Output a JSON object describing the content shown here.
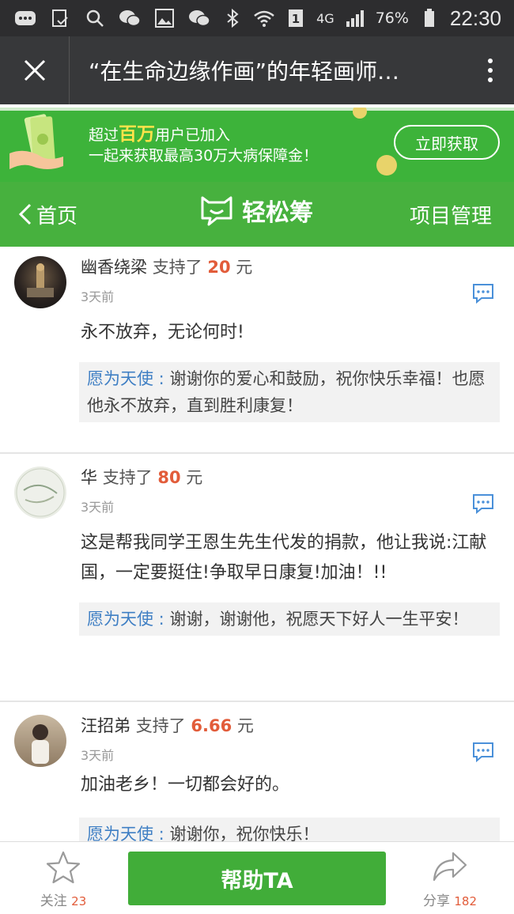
{
  "status_bar": {
    "network": "4G",
    "battery": "76%",
    "time": "22:30"
  },
  "title_bar": {
    "title": "“在生命边缘作画”的年轻画师…"
  },
  "banner": {
    "line1_pre": "超过",
    "line1_highlight": "百万",
    "line1_post": "用户已加入",
    "line2": "一起来获取最高30万大病保障金！",
    "button": "立即获取"
  },
  "nav": {
    "back_label": "首页",
    "brand": "轻松筹",
    "manage": "项目管理"
  },
  "comments": [
    {
      "name": "幽香绕梁",
      "support_prefix": "支持了",
      "amount": "20",
      "unit": "元",
      "time": "3天前",
      "message": "永不放弃，无论何时!",
      "reply_author": "愿为天使 :",
      "reply_text": " 谢谢你的爱心和鼓励，祝你快乐幸福！也愿他永不放弃，直到胜利康复！"
    },
    {
      "name": "华",
      "support_prefix": "支持了",
      "amount": "80",
      "unit": "元",
      "time": "3天前",
      "message": "这是帮我同学王恩生先生代发的捐款，他让我说:江献国，一定要挺住!争取早日康复!加油！!!",
      "reply_author": "愿为天使 :",
      "reply_text": " 谢谢，谢谢他，祝愿天下好人一生平安！"
    },
    {
      "name": "汪招弟",
      "support_prefix": "支持了",
      "amount": "6.66",
      "unit": "元",
      "time": "3天前",
      "message": "加油老乡！一切都会好的。",
      "reply_author": "愿为天使 :",
      "reply_text": " 谢谢你，祝你快乐！"
    }
  ],
  "bottom_bar": {
    "follow_label": "关注",
    "follow_count": "23",
    "help_button": "帮助TA",
    "share_label": "分享",
    "share_count": "182"
  }
}
